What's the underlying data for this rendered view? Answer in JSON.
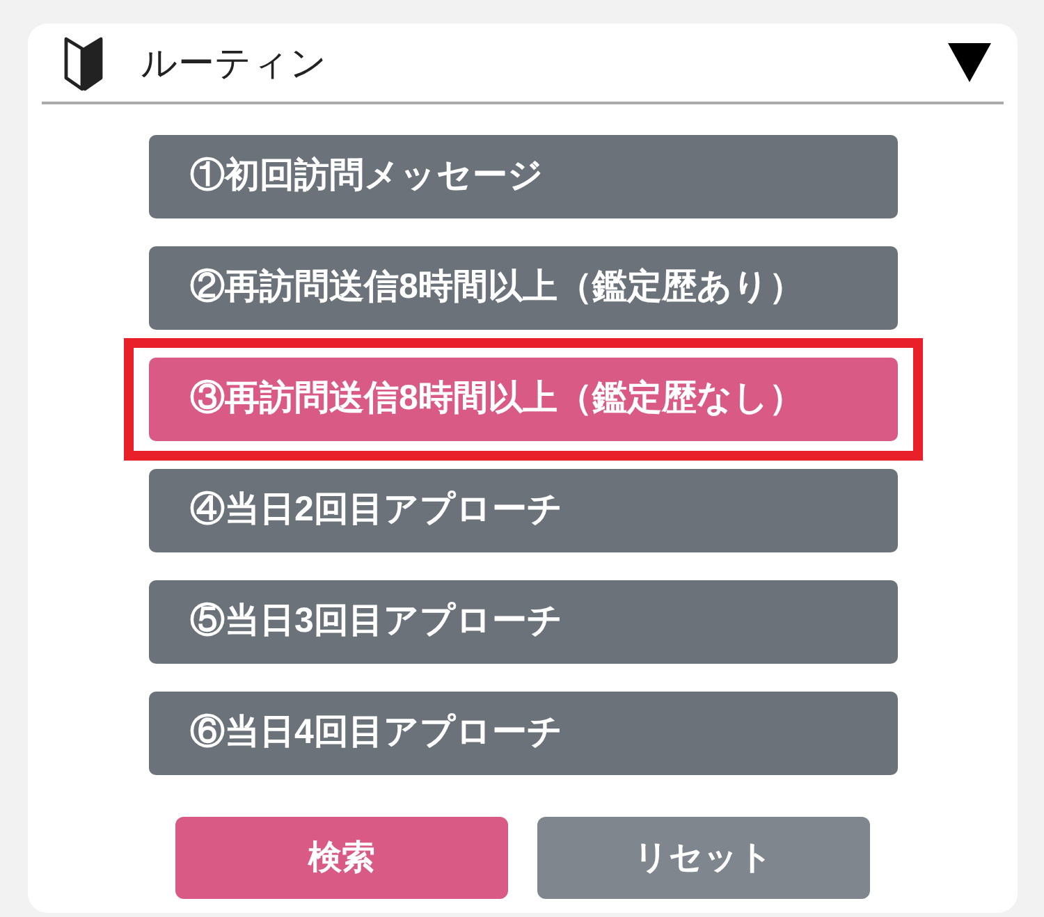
{
  "header": {
    "title": "ルーティン"
  },
  "routines": [
    {
      "label": "①初回訪問メッセージ",
      "selected": false
    },
    {
      "label": "②再訪問送信8時間以上（鑑定歴あり）",
      "selected": false
    },
    {
      "label": "③再訪問送信8時間以上（鑑定歴なし）",
      "selected": true
    },
    {
      "label": "④当日2回目アプローチ",
      "selected": false
    },
    {
      "label": "⑤当日3回目アプローチ",
      "selected": false
    },
    {
      "label": "⑥当日4回目アプローチ",
      "selected": false
    }
  ],
  "actions": [
    {
      "label": "検索",
      "kind": "primary"
    },
    {
      "label": "リセット",
      "kind": "secondary"
    }
  ]
}
